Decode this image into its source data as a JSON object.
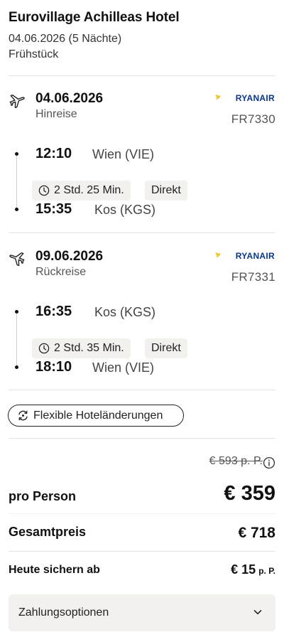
{
  "hotel": {
    "name": "Eurovillage Achilleas Hotel",
    "dates": "04.06.2026 (5 Nächte)",
    "board": "Frühstück"
  },
  "outbound": {
    "date": "04.06.2026",
    "direction": "Hinreise",
    "airline_logo_text": "RYANAIR",
    "flight_number": "FR7330",
    "depart_time": "12:10",
    "depart_place": "Wien (VIE)",
    "duration": "2 Std. 25 Min.",
    "stops": "Direkt",
    "arrive_time": "15:35",
    "arrive_place": "Kos (KGS)"
  },
  "inbound": {
    "date": "09.06.2026",
    "direction": "Rückreise",
    "airline_logo_text": "RYANAIR",
    "flight_number": "FR7331",
    "depart_time": "16:35",
    "depart_place": "Kos (KGS)",
    "duration": "2 Std. 35 Min.",
    "stops": "Direkt",
    "arrive_time": "18:10",
    "arrive_place": "Wien (VIE)"
  },
  "flex_changes_label": "Flexible Hoteländerungen",
  "pricing": {
    "old_price": "€ 593 p. P.",
    "per_person_label": "pro Person",
    "per_person_value": "€ 359",
    "total_label": "Gesamtpreis",
    "total_value": "€ 718",
    "secure_label": "Heute sichern ab",
    "secure_value": "€ 15",
    "secure_unit": "p. P."
  },
  "payment_options_label": "Zahlungsoptionen",
  "colors": {
    "ryanair_blue": "#073590",
    "ryanair_yellow": "#f1c933",
    "chip_bg": "#f3f1ed"
  }
}
